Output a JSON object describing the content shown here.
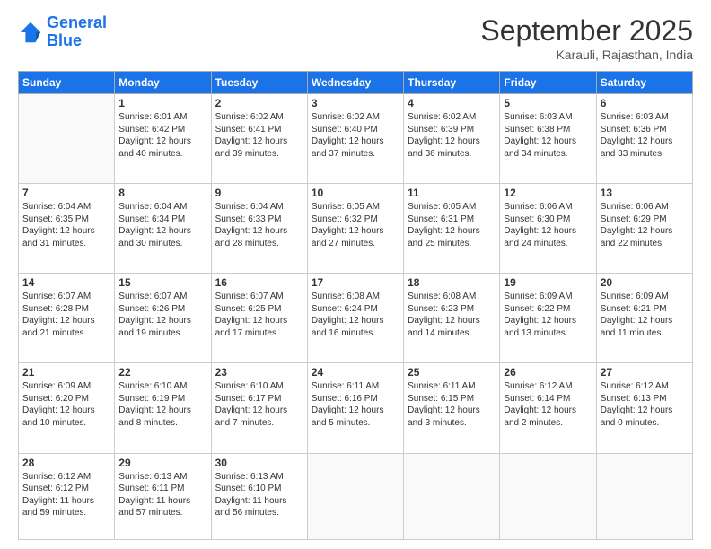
{
  "logo": {
    "line1": "General",
    "line2": "Blue"
  },
  "title": "September 2025",
  "location": "Karauli, Rajasthan, India",
  "weekdays": [
    "Sunday",
    "Monday",
    "Tuesday",
    "Wednesday",
    "Thursday",
    "Friday",
    "Saturday"
  ],
  "weeks": [
    [
      {
        "day": "",
        "info": ""
      },
      {
        "day": "1",
        "info": "Sunrise: 6:01 AM\nSunset: 6:42 PM\nDaylight: 12 hours\nand 40 minutes."
      },
      {
        "day": "2",
        "info": "Sunrise: 6:02 AM\nSunset: 6:41 PM\nDaylight: 12 hours\nand 39 minutes."
      },
      {
        "day": "3",
        "info": "Sunrise: 6:02 AM\nSunset: 6:40 PM\nDaylight: 12 hours\nand 37 minutes."
      },
      {
        "day": "4",
        "info": "Sunrise: 6:02 AM\nSunset: 6:39 PM\nDaylight: 12 hours\nand 36 minutes."
      },
      {
        "day": "5",
        "info": "Sunrise: 6:03 AM\nSunset: 6:38 PM\nDaylight: 12 hours\nand 34 minutes."
      },
      {
        "day": "6",
        "info": "Sunrise: 6:03 AM\nSunset: 6:36 PM\nDaylight: 12 hours\nand 33 minutes."
      }
    ],
    [
      {
        "day": "7",
        "info": "Sunrise: 6:04 AM\nSunset: 6:35 PM\nDaylight: 12 hours\nand 31 minutes."
      },
      {
        "day": "8",
        "info": "Sunrise: 6:04 AM\nSunset: 6:34 PM\nDaylight: 12 hours\nand 30 minutes."
      },
      {
        "day": "9",
        "info": "Sunrise: 6:04 AM\nSunset: 6:33 PM\nDaylight: 12 hours\nand 28 minutes."
      },
      {
        "day": "10",
        "info": "Sunrise: 6:05 AM\nSunset: 6:32 PM\nDaylight: 12 hours\nand 27 minutes."
      },
      {
        "day": "11",
        "info": "Sunrise: 6:05 AM\nSunset: 6:31 PM\nDaylight: 12 hours\nand 25 minutes."
      },
      {
        "day": "12",
        "info": "Sunrise: 6:06 AM\nSunset: 6:30 PM\nDaylight: 12 hours\nand 24 minutes."
      },
      {
        "day": "13",
        "info": "Sunrise: 6:06 AM\nSunset: 6:29 PM\nDaylight: 12 hours\nand 22 minutes."
      }
    ],
    [
      {
        "day": "14",
        "info": "Sunrise: 6:07 AM\nSunset: 6:28 PM\nDaylight: 12 hours\nand 21 minutes."
      },
      {
        "day": "15",
        "info": "Sunrise: 6:07 AM\nSunset: 6:26 PM\nDaylight: 12 hours\nand 19 minutes."
      },
      {
        "day": "16",
        "info": "Sunrise: 6:07 AM\nSunset: 6:25 PM\nDaylight: 12 hours\nand 17 minutes."
      },
      {
        "day": "17",
        "info": "Sunrise: 6:08 AM\nSunset: 6:24 PM\nDaylight: 12 hours\nand 16 minutes."
      },
      {
        "day": "18",
        "info": "Sunrise: 6:08 AM\nSunset: 6:23 PM\nDaylight: 12 hours\nand 14 minutes."
      },
      {
        "day": "19",
        "info": "Sunrise: 6:09 AM\nSunset: 6:22 PM\nDaylight: 12 hours\nand 13 minutes."
      },
      {
        "day": "20",
        "info": "Sunrise: 6:09 AM\nSunset: 6:21 PM\nDaylight: 12 hours\nand 11 minutes."
      }
    ],
    [
      {
        "day": "21",
        "info": "Sunrise: 6:09 AM\nSunset: 6:20 PM\nDaylight: 12 hours\nand 10 minutes."
      },
      {
        "day": "22",
        "info": "Sunrise: 6:10 AM\nSunset: 6:19 PM\nDaylight: 12 hours\nand 8 minutes."
      },
      {
        "day": "23",
        "info": "Sunrise: 6:10 AM\nSunset: 6:17 PM\nDaylight: 12 hours\nand 7 minutes."
      },
      {
        "day": "24",
        "info": "Sunrise: 6:11 AM\nSunset: 6:16 PM\nDaylight: 12 hours\nand 5 minutes."
      },
      {
        "day": "25",
        "info": "Sunrise: 6:11 AM\nSunset: 6:15 PM\nDaylight: 12 hours\nand 3 minutes."
      },
      {
        "day": "26",
        "info": "Sunrise: 6:12 AM\nSunset: 6:14 PM\nDaylight: 12 hours\nand 2 minutes."
      },
      {
        "day": "27",
        "info": "Sunrise: 6:12 AM\nSunset: 6:13 PM\nDaylight: 12 hours\nand 0 minutes."
      }
    ],
    [
      {
        "day": "28",
        "info": "Sunrise: 6:12 AM\nSunset: 6:12 PM\nDaylight: 11 hours\nand 59 minutes."
      },
      {
        "day": "29",
        "info": "Sunrise: 6:13 AM\nSunset: 6:11 PM\nDaylight: 11 hours\nand 57 minutes."
      },
      {
        "day": "30",
        "info": "Sunrise: 6:13 AM\nSunset: 6:10 PM\nDaylight: 11 hours\nand 56 minutes."
      },
      {
        "day": "",
        "info": ""
      },
      {
        "day": "",
        "info": ""
      },
      {
        "day": "",
        "info": ""
      },
      {
        "day": "",
        "info": ""
      }
    ]
  ]
}
